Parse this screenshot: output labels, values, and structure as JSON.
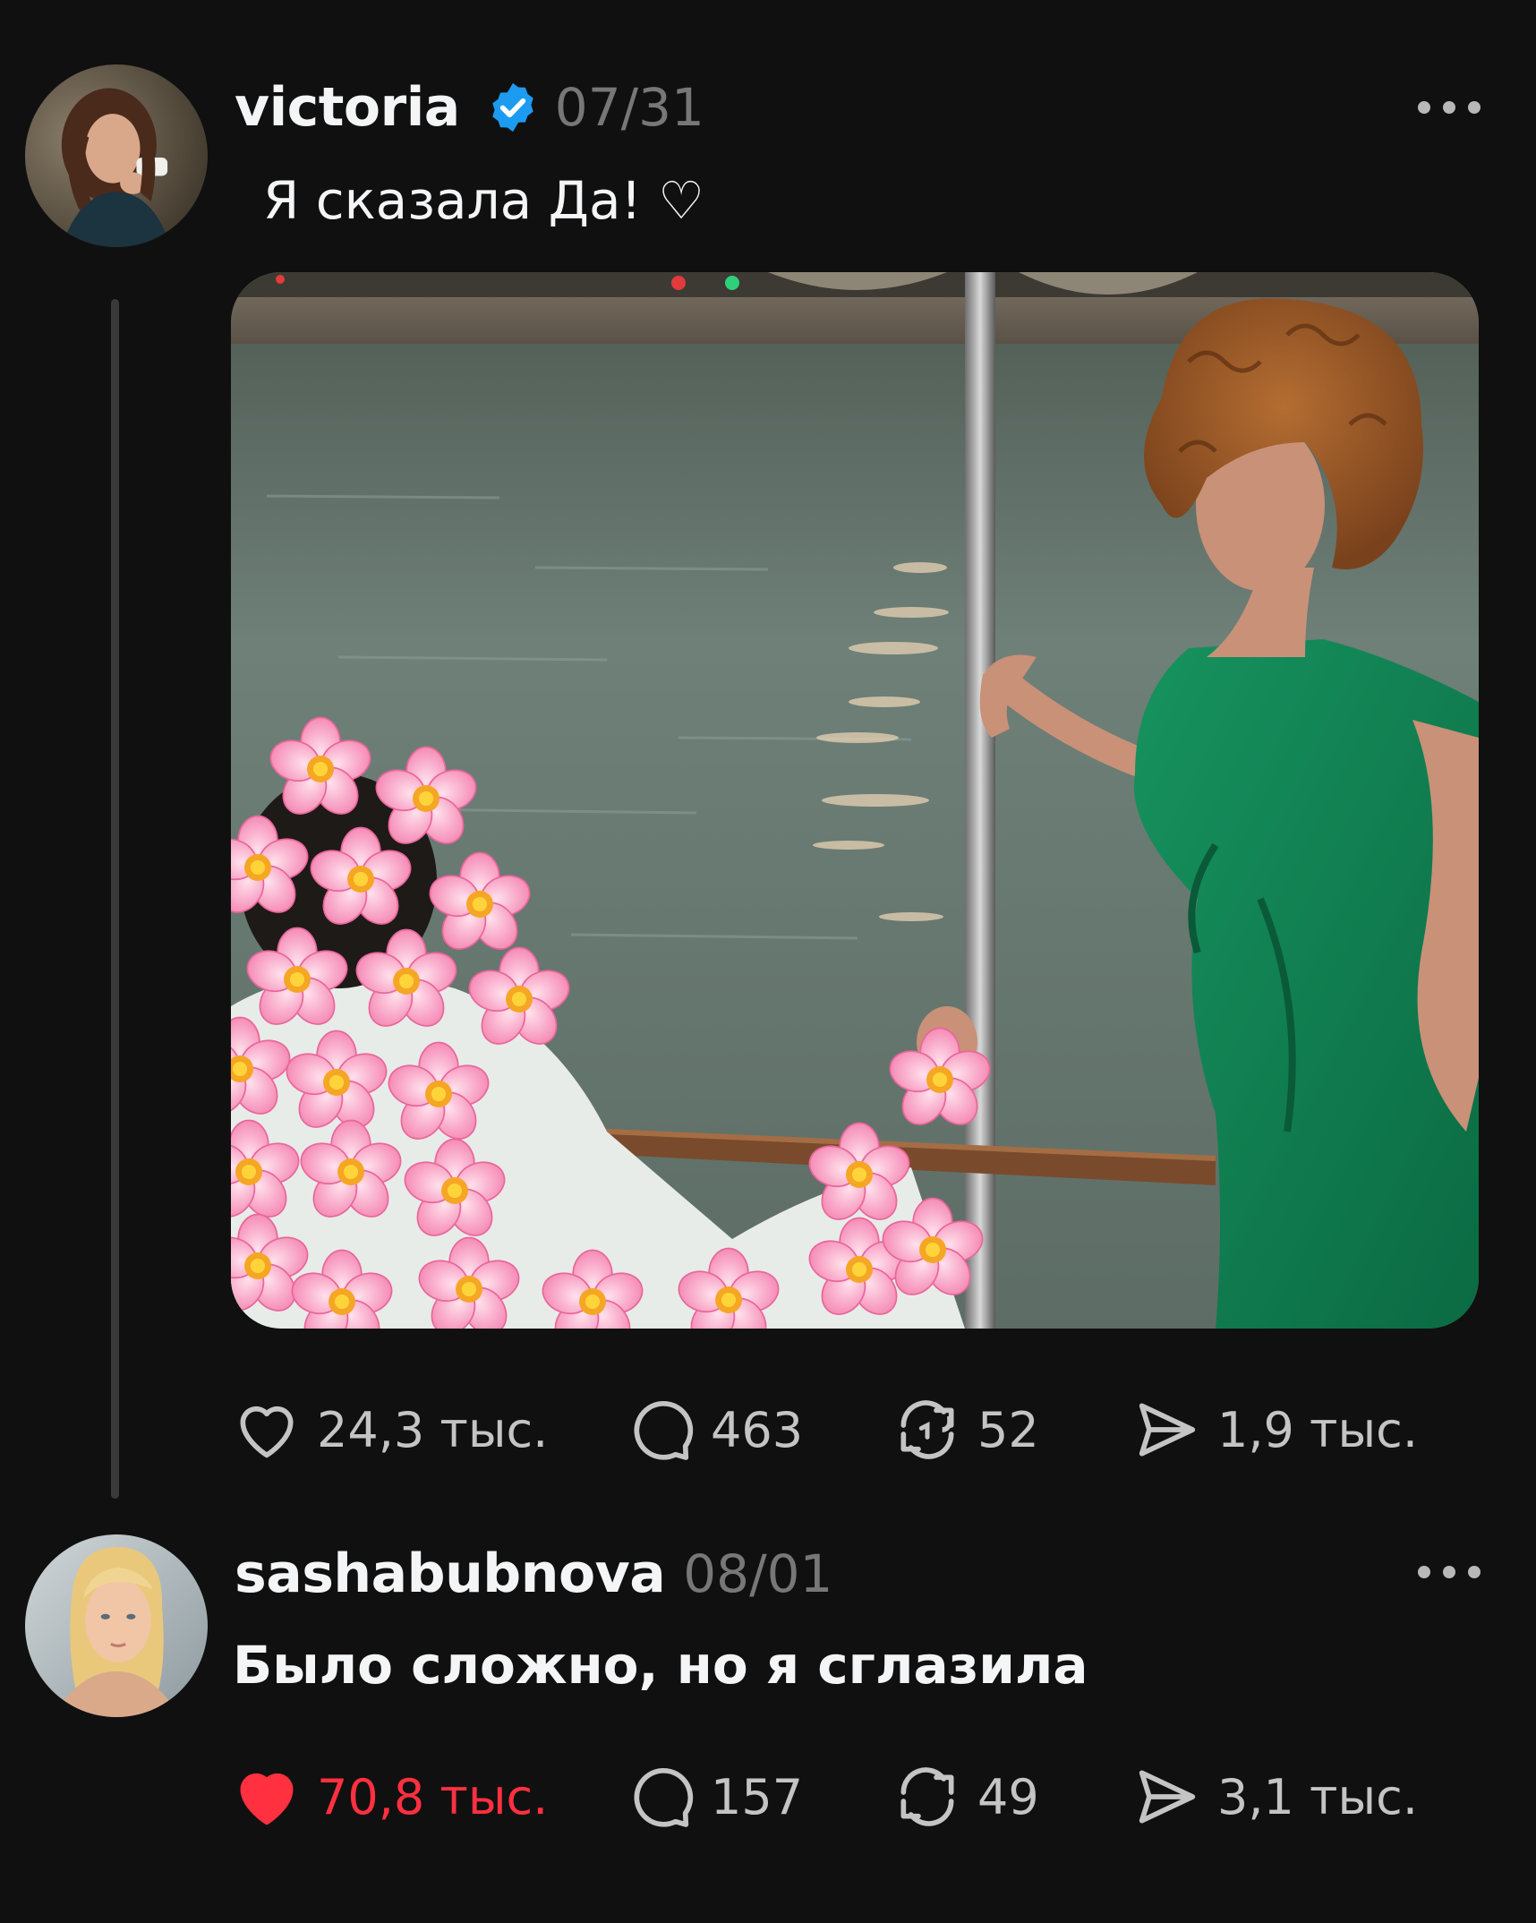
{
  "colors": {
    "background": "#101010",
    "text_primary": "#f3f5f7",
    "text_secondary": "#777777",
    "action_gray": "#c4c4c4",
    "verified_blue": "#1d9bf0",
    "like_red": "#ff3040"
  },
  "posts": [
    {
      "username": "victoria",
      "verified": true,
      "date": "07/31",
      "text": "Я сказала Да! ♡",
      "has_image": true,
      "image_description_icon": "photo-woman-green-dress-boat",
      "actions": {
        "likes": "24,3 тыс.",
        "liked": false,
        "replies": "463",
        "reposts": "52",
        "shares": "1,9 тыс."
      }
    },
    {
      "username": "sashabubnova",
      "verified": false,
      "date": "08/01",
      "text": "Было сложно, но я сглазила",
      "has_image": false,
      "actions": {
        "likes": "70,8 тыс.",
        "liked": true,
        "replies": "157",
        "reposts": "49",
        "shares": "3,1 тыс."
      }
    }
  ],
  "icons": {
    "like": "heart-icon",
    "like_filled": "heart-filled-icon",
    "reply": "speech-bubble-icon",
    "repost": "repost-icon",
    "share": "send-icon",
    "more": "more-dots-icon",
    "verified": "verified-badge-icon"
  }
}
